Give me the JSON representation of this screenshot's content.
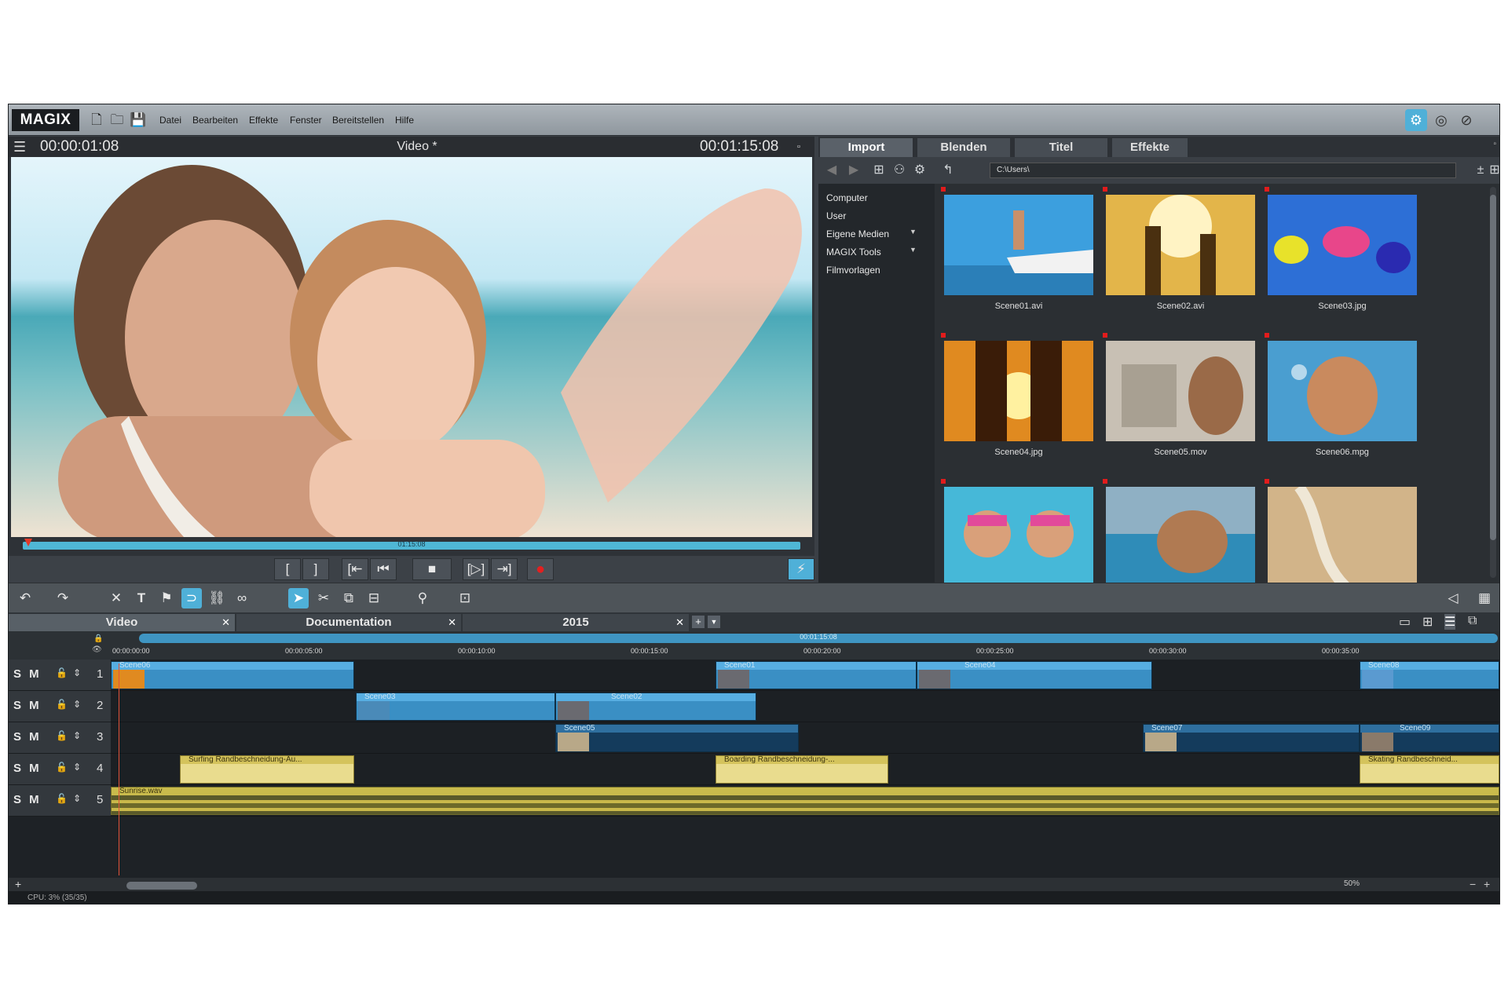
{
  "app": {
    "logo": "MAGIX",
    "menu": [
      "Datei",
      "Bearbeiten",
      "Effekte",
      "Fenster",
      "Bereitstellen",
      "Hilfe"
    ]
  },
  "preview": {
    "timecode_left": "00:00:01:08",
    "title": "Video *",
    "timecode_right": "00:01:15:08",
    "scrub_label": "01:15:08",
    "transport": [
      "[",
      "]",
      "[⇤",
      "⏮",
      "■",
      "[▷]",
      "⇥]",
      "●"
    ]
  },
  "browser": {
    "tabs": [
      "Import",
      "Blenden",
      "Titel",
      "Effekte"
    ],
    "path": "C:\\Users\\",
    "folders": [
      "Computer",
      "User",
      "Eigene Medien",
      "MAGIX Tools",
      "Filmvorlagen"
    ],
    "files": [
      "Scene01.avi",
      "Scene02.avi",
      "Scene03.jpg",
      "Scene04.jpg",
      "Scene05.mov",
      "Scene06.mpg",
      "",
      "",
      ""
    ]
  },
  "timeline": {
    "tabs": [
      "Video",
      "Documentation",
      "2015"
    ],
    "range_label": "00:01:15:08",
    "ruler": [
      "00:00:00:00",
      "00:00:05:00",
      "00:00:10:00",
      "00:00:15:00",
      "00:00:20:00",
      "00:00:25:00",
      "00:00:30:00",
      "00:00:35:00"
    ],
    "tracks": [
      {
        "label": "S M",
        "number": "1"
      },
      {
        "label": "S M",
        "number": "2"
      },
      {
        "label": "S M",
        "number": "3"
      },
      {
        "label": "S M",
        "number": "4"
      },
      {
        "label": "S M",
        "number": "5"
      }
    ],
    "clips": {
      "t1": [
        "Scene06",
        "Scene01",
        "Scene04",
        "Scene08"
      ],
      "t2": [
        "Scene03",
        "Scene02"
      ],
      "t3": [
        "Scene05",
        "Scene07",
        "Scene09"
      ],
      "t4": [
        "Surfing   Randbeschneidung-Au...",
        "Boarding   Randbeschneidung-...",
        "Skating   Randbeschneid..."
      ],
      "t5": [
        "Sunrise.wav"
      ]
    },
    "zoom": "50%"
  },
  "status": "CPU: 3% (35/35)"
}
